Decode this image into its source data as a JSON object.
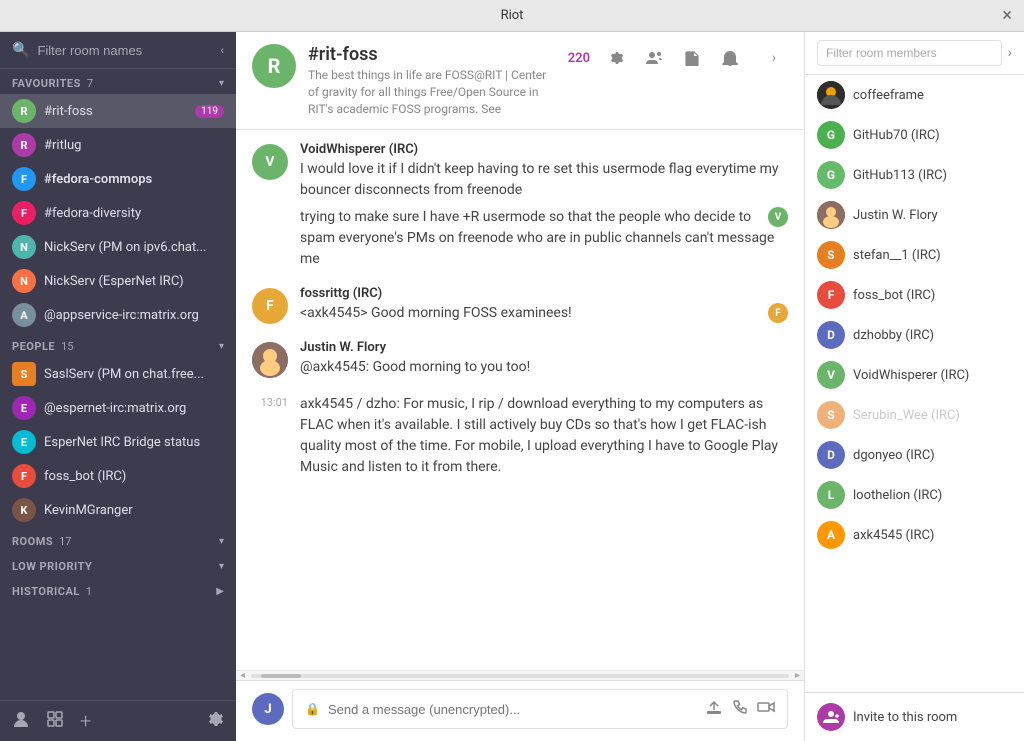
{
  "titlebar": {
    "title": "Riot",
    "close": "×"
  },
  "sidebar": {
    "search": {
      "placeholder": "Filter room names"
    },
    "collapse_icon": "‹",
    "sections": {
      "favourites": {
        "label": "FAVOURITES",
        "count": "7",
        "items": [
          {
            "id": "rit-foss",
            "label": "#rit-foss",
            "badge": "119",
            "badge_type": "purple",
            "color": "#6ab56a",
            "initial": "R"
          },
          {
            "id": "ritlug",
            "label": "#ritlug",
            "badge": "",
            "badge_type": "",
            "color": "#ac3ba8",
            "initial": "R"
          },
          {
            "id": "fedora-commops",
            "label": "#fedora-commops",
            "badge": "",
            "badge_type": "",
            "color": "#2196f3",
            "initial": "F"
          },
          {
            "id": "fedora-diversity",
            "label": "#fedora-diversity",
            "badge": "",
            "badge_type": "",
            "color": "#e91e63",
            "initial": "F"
          },
          {
            "id": "nickserv-ipv6",
            "label": "NickServ (PM on ipv6.chat...",
            "badge": "",
            "badge_type": "",
            "color": "#4db6ac",
            "initial": "N"
          },
          {
            "id": "nickserv-espernet",
            "label": "NickServ (EsperNet IRC)",
            "badge": "",
            "badge_type": "",
            "color": "#ff7043",
            "initial": "N"
          },
          {
            "id": "appservice",
            "label": "@appservice-irc:matrix.org",
            "badge": "",
            "badge_type": "",
            "color": "#78909c",
            "initial": "A"
          }
        ]
      },
      "people": {
        "label": "PEOPLE",
        "count": "15",
        "items": [
          {
            "id": "saslserv",
            "label": "SaslServ (PM on chat.free...",
            "badge": "",
            "color": "#e67e22",
            "initial": "S"
          },
          {
            "id": "espernet-irc",
            "label": "@espernet-irc:matrix.org",
            "badge": "",
            "color": "#9c27b0",
            "initial": "E"
          },
          {
            "id": "espernet-bridge",
            "label": "EsperNet IRC Bridge status",
            "badge": "",
            "color": "#00bcd4",
            "initial": "E"
          },
          {
            "id": "foss-bot",
            "label": "foss_bot (IRC)",
            "badge": "",
            "color": "#e74c3c",
            "initial": "F"
          },
          {
            "id": "kevinmgranger",
            "label": "KevinMGranger",
            "badge": "",
            "color": null,
            "initial": "K",
            "is_photo": true
          }
        ]
      },
      "rooms": {
        "label": "ROOMS",
        "count": "17"
      },
      "low_priority": {
        "label": "LOW PRIORITY",
        "count": ""
      },
      "historical": {
        "label": "HISTORICAL",
        "count": "1"
      }
    },
    "bottom_icons": {
      "user": "👤",
      "rooms": "🏠",
      "add": "+",
      "settings": "⚙"
    }
  },
  "room": {
    "name": "#rit-foss",
    "initial": "R",
    "avatar_color": "#6ab56a",
    "topic": "The best things in life are FOSS@RIT | Center of gravity for all things Free/Open Source in RIT's academic FOSS programs. See",
    "member_count": "220",
    "header_icons": {
      "settings": "⚙",
      "members": "👥",
      "files": "📄",
      "notifications": "🔔"
    }
  },
  "messages": [
    {
      "id": "msg1",
      "sender": "VoidWhisperer (IRC)",
      "avatar_color": "#6ab56a",
      "initial": "V",
      "show_v_badge": true,
      "texts": [
        "I would love it if I didn't keep having to re set this usermode flag everytime my bouncer disconnects from freenode",
        "trying to make sure I have +R usermode so that the people who decide to spam everyone's PMs on freenode who are in public channels can't message me"
      ],
      "time": ""
    },
    {
      "id": "msg2",
      "sender": "fossrittg (IRC)",
      "avatar_color": "#e8a838",
      "initial": "F",
      "show_f_badge": true,
      "texts": [
        "<axk4545> Good morning FOSS examinees!"
      ],
      "time": ""
    },
    {
      "id": "msg3",
      "sender": "Justin W. Flory",
      "avatar_color": null,
      "initial": "J",
      "is_photo": true,
      "texts": [
        "@axk4545: Good morning to you too!"
      ],
      "time": ""
    },
    {
      "id": "msg4",
      "sender": "Justin W. Flory",
      "avatar_color": null,
      "initial": "J",
      "is_photo": true,
      "show_time": true,
      "time": "13:01",
      "texts": [
        "axk4545 / dzho: For music, I rip / download everything to my computers as FLAC when it's available. I still actively buy CDs so that's how I get FLAC-ish quality most of the time. For mobile, I upload everything I have to Google Play Music and listen to it from there."
      ]
    }
  ],
  "input": {
    "placeholder": "Send a message (unencrypted)...",
    "lock_icon": "🔒"
  },
  "right_panel": {
    "filter_placeholder": "Filter room members",
    "members": [
      {
        "id": "coffeeframe",
        "name": "coffeeframe",
        "color": null,
        "initial": "C",
        "is_dark": true
      },
      {
        "id": "github70",
        "name": "GitHub70 (IRC)",
        "color": "#4caf50",
        "initial": "G"
      },
      {
        "id": "github113",
        "name": "GitHub113 (IRC)",
        "color": "#66bb6a",
        "initial": "G"
      },
      {
        "id": "justin",
        "name": "Justin W. Flory",
        "color": null,
        "initial": "J",
        "is_photo": true
      },
      {
        "id": "stefan1",
        "name": "stefan__1 (IRC)",
        "color": "#e67e22",
        "initial": "S"
      },
      {
        "id": "foss_bot",
        "name": "foss_bot (IRC)",
        "color": "#e74c3c",
        "initial": "F"
      },
      {
        "id": "dzhobby",
        "name": "dzhobby (IRC)",
        "color": "#5c6bc0",
        "initial": "D"
      },
      {
        "id": "voidwhisperer",
        "name": "VoidWhisperer (IRC)",
        "color": "#6ab56a",
        "initial": "V"
      },
      {
        "id": "serubin_wee",
        "name": "Serubin_Wee (IRC)",
        "color": "#e67e22",
        "initial": "S",
        "muted": true
      },
      {
        "id": "dgonyeo",
        "name": "dgonyeo (IRC)",
        "color": "#5c6bc0",
        "initial": "D"
      },
      {
        "id": "loothelion",
        "name": "loothelion (IRC)",
        "color": "#6ab56a",
        "initial": "L"
      },
      {
        "id": "axk4545",
        "name": "axk4545 (IRC)",
        "color": "#ff9800",
        "initial": "A"
      }
    ],
    "invite_label": "Invite to this room"
  }
}
